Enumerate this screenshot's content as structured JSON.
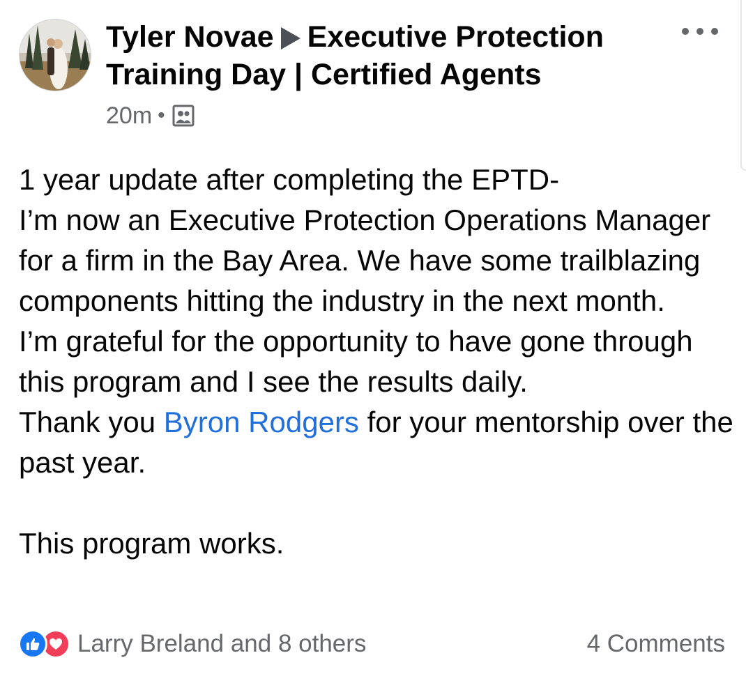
{
  "post": {
    "author": "Tyler Novae",
    "group": "Executive Protection Training Day | Certified Agents",
    "time": "20m",
    "separator": "•",
    "audience_icon": "group-members-icon",
    "more_icon": "more-options-icon"
  },
  "body": {
    "line1": "1 year update after completing the EPTD-",
    "para2": "I’m now an Executive Protection Operations Manager for a firm in the Bay Area. We have some trailblazing components hitting the industry in the next month.",
    "para3": "I’m grateful for the opportunity to have gone through this program and I see the results daily.",
    "thanks_pre": "Thank you ",
    "mention": "Byron Rodgers",
    "thanks_post": " for your mentorship over the past year.",
    "closing": "This program works."
  },
  "footer": {
    "reaction_icons": [
      "like-icon",
      "love-icon"
    ],
    "reactions_text": "Larry Breland and 8 others",
    "comments": "4 Comments"
  },
  "colors": {
    "mention": "#216fdb",
    "like": "#1877f2",
    "love": "#f33e58",
    "secondary_text": "#65676b"
  }
}
